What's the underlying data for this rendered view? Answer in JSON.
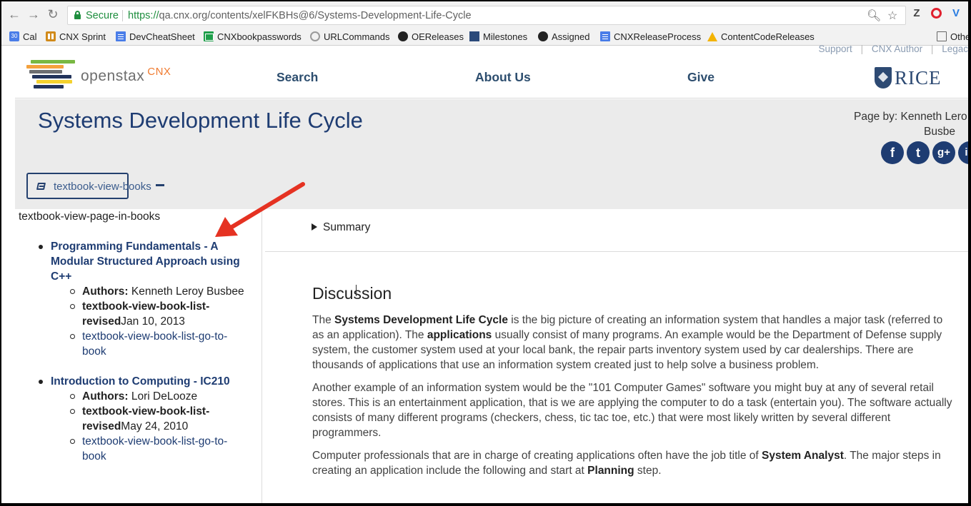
{
  "browser": {
    "secure_label": "Secure",
    "url_scheme": "https://",
    "url_rest": "qa.cnx.org/contents/xelFKBHs@6/Systems-Development-Life-Cycle",
    "ext_z": "Z",
    "ext_v": "V"
  },
  "bookmarks": {
    "cal": "Cal",
    "cal_icon_text": "30",
    "cnx_sprint": "CNX Sprint",
    "devcheatsheet": "DevCheatSheet",
    "cnxbookpasswords": "CNXbookpasswords",
    "urlcommands": "URLCommands",
    "oereleases": "OEReleases",
    "milestones": "Milestones",
    "assigned": "Assigned",
    "cnxreleaseprocess": "CNXReleaseProcess",
    "contentcodereleases": "ContentCodeReleases",
    "other": "Other"
  },
  "header": {
    "support": "Support",
    "cnx_author": "CNX Author",
    "legacy": "Legac",
    "logo_word": "openstax",
    "logo_cnx": "CNX",
    "nav_search": "Search",
    "nav_about": "About Us",
    "nav_give": "Give",
    "rice": "RICE"
  },
  "page": {
    "title": "Systems Development Life Cycle",
    "page_by_line1": "Page by: Kenneth Lero",
    "page_by_line2": "Busbe",
    "books_button": "textbook-view-books"
  },
  "social": {
    "facebook": "f",
    "twitter": "t",
    "googleplus": "g+",
    "linkedin": "in"
  },
  "books_panel": {
    "heading": "textbook-view-page-in-books",
    "authors_label": "Authors:",
    "revised_label_1": "textbook-view-book-list-",
    "revised_label_2": "revised",
    "link_line1": "textbook-view-book-list-go-to-",
    "link_line2": "book",
    "books": [
      {
        "title_line1": "Programming Fundamentals - A",
        "title_line2": "Modular Structured Approach using",
        "title_line3": "C++",
        "authors": "Kenneth Leroy Busbee",
        "revised": "Jan 10, 2013"
      },
      {
        "title_line1": "Introduction to Computing - IC210",
        "authors": "Lori DeLooze",
        "revised": "May 24, 2010"
      }
    ]
  },
  "content": {
    "summary": "Summary",
    "heading": "Discussion",
    "p1": [
      "The ",
      "Systems Development Life Cycle",
      " is the big picture of creating an information system that handles a major task (referred to as an application). The ",
      "applications",
      " usually consist of many programs. An example would be the Department of Defense supply system, the customer system used at your local bank, the repair parts inventory system used by car dealerships. There are thousands of applications that use an information system created just to help solve a business problem."
    ],
    "p2": "Another example of an information system would be the \"101 Computer Games\" software you might buy at any of several retail stores. This is an entertainment application, that is we are applying the computer to do a task (entertain you). The software actually consists of many different programs (checkers, chess, tic tac toe, etc.) that were most likely written by several different programmers.",
    "p3": [
      "Computer professionals that are in charge of creating applications often have the job title of ",
      "System Analyst",
      ". The major steps in creating an application include the following and start at ",
      "Planning",
      " step."
    ]
  },
  "colors": {
    "brand_navy": "#1e3c72",
    "annotation_arrow": "#e53222",
    "secure_green": "#1e8e3e",
    "cnx_orange": "#f07b30"
  }
}
